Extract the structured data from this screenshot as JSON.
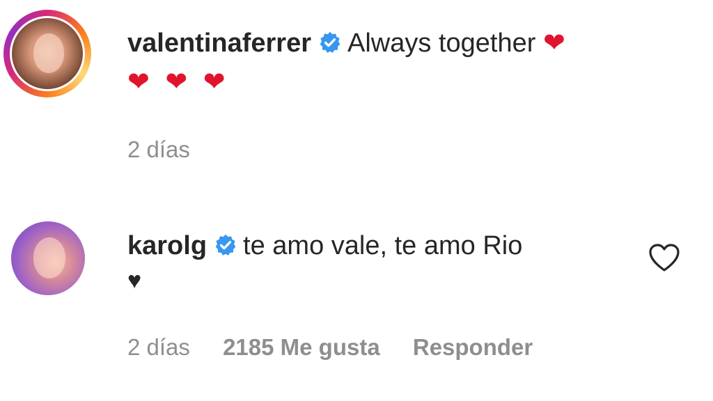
{
  "comments": [
    {
      "username": "valentinaferrer",
      "verified": true,
      "text": "Always together",
      "emoji_line1": "❤",
      "emoji_line2": "❤ ❤ ❤",
      "time": "2 días",
      "avatar_icon": "profile-photo-with-story-ring"
    },
    {
      "username": "karolg",
      "verified": true,
      "text": "te amo vale, te amo Rio",
      "emoji_line2": "♥",
      "time": "2 días",
      "likes": "2185 Me gusta",
      "reply": "Responder",
      "avatar_icon": "profile-photo"
    }
  ],
  "colors": {
    "verified": "#3897f0",
    "meta_text": "#8e8e8e",
    "heart": "#e0142d",
    "text": "#262626"
  }
}
